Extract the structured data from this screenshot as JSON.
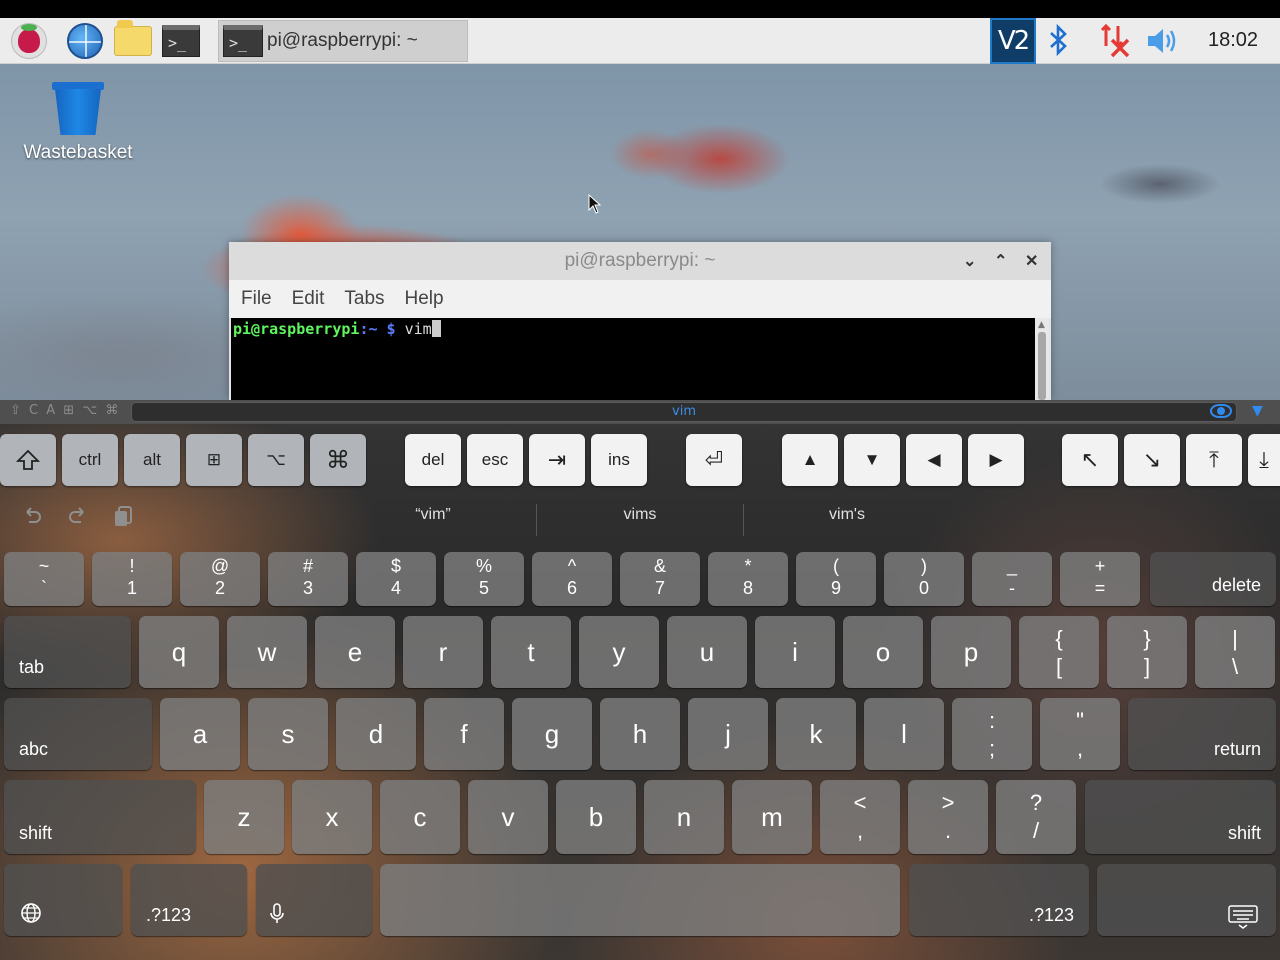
{
  "taskbar": {
    "active_task": "pi@raspberrypi: ~",
    "clock": "18:02",
    "vnc_label": "V2"
  },
  "desktop": {
    "wastebasket_label": "Wastebasket"
  },
  "terminal": {
    "title": "pi@raspberrypi: ~",
    "menu": [
      "File",
      "Edit",
      "Tabs",
      "Help"
    ],
    "prompt_user": "pi@raspberrypi",
    "prompt_path": ":~ $",
    "command": " vim"
  },
  "keyboard": {
    "status_mods": "⇧ C A ⊞ ⌥ ⌘",
    "input_text": "vim",
    "toolbar": {
      "ctrl": "ctrl",
      "alt": "alt",
      "win": "⊞",
      "option": "⌥",
      "command": "⌘",
      "shift": "⇧",
      "del": "del",
      "esc": "esc",
      "tab_arrow": "⇥",
      "ins": "ins",
      "enter": "⏎",
      "up": "▲",
      "down": "▼",
      "left": "◀",
      "right": "▶",
      "home": "↖",
      "end": "↘",
      "pgup": "⤒",
      "pgdn": "⤓"
    },
    "suggestions": [
      "“vim”",
      "vims",
      "vim's"
    ],
    "num_row": [
      {
        "top": "~",
        "bot": "`"
      },
      {
        "top": "!",
        "bot": "1"
      },
      {
        "top": "@",
        "bot": "2"
      },
      {
        "top": "#",
        "bot": "3"
      },
      {
        "top": "$",
        "bot": "4"
      },
      {
        "top": "%",
        "bot": "5"
      },
      {
        "top": "^",
        "bot": "6"
      },
      {
        "top": "&",
        "bot": "7"
      },
      {
        "top": "*",
        "bot": "8"
      },
      {
        "top": "(",
        "bot": "9"
      },
      {
        "top": ")",
        "bot": "0"
      },
      {
        "top": "_",
        "bot": "-"
      },
      {
        "top": "+",
        "bot": "="
      }
    ],
    "delete": "delete",
    "tab": "tab",
    "row_q": [
      "q",
      "w",
      "e",
      "r",
      "t",
      "y",
      "u",
      "i",
      "o",
      "p"
    ],
    "brackets": [
      {
        "top": "{",
        "bot": "["
      },
      {
        "top": "}",
        "bot": "]"
      },
      {
        "top": "|",
        "bot": "\\"
      }
    ],
    "abc": "abc",
    "row_a": [
      "a",
      "s",
      "d",
      "f",
      "g",
      "h",
      "j",
      "k",
      "l"
    ],
    "semi": {
      "top": ":",
      "bot": ";"
    },
    "quote": {
      "top": "\"",
      "bot": ","
    },
    "return": "return",
    "shift": "shift",
    "row_z": [
      "z",
      "x",
      "c",
      "v",
      "b",
      "n",
      "m"
    ],
    "punct": [
      {
        "top": "<",
        "bot": ","
      },
      {
        "top": ">",
        "bot": "."
      },
      {
        "top": "?",
        "bot": "/"
      }
    ],
    "num_switch": ".?123"
  }
}
